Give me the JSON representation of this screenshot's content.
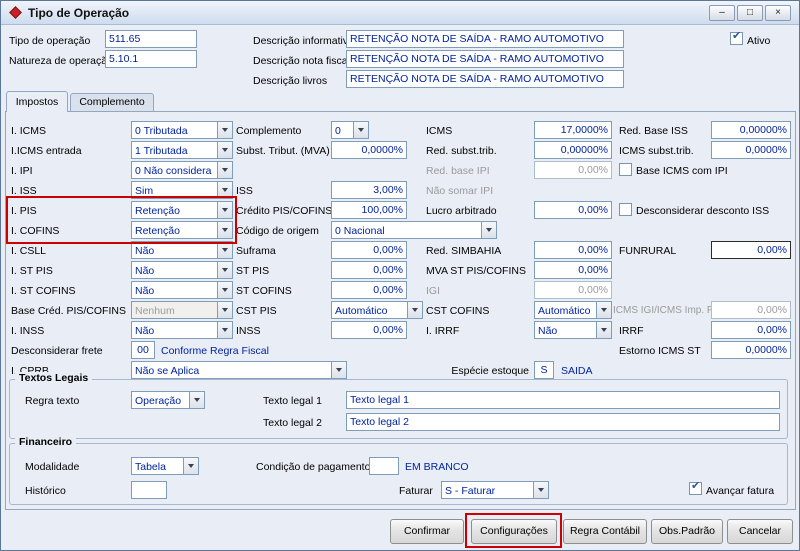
{
  "titlebar": {
    "title": "Tipo de Operação"
  },
  "icons": {
    "minimize": "–",
    "maximize": "□",
    "close": "×",
    "check": "✔",
    "dropdown": "▾"
  },
  "colors": {
    "annotation_red": "#CC0000",
    "field_text_blue": "#0023A0"
  },
  "header": {
    "tipo": {
      "label": "Tipo de operação",
      "value": "511.65"
    },
    "natureza": {
      "label": "Natureza de operação",
      "value": "5.10.1"
    },
    "desc_informativa": {
      "label": "Descrição informativa",
      "value": "RETENÇÃO NOTA DE SAÍDA - RAMO AUTOMOTIVO"
    },
    "desc_nota_fiscal": {
      "label": "Descrição nota fiscal",
      "value": "RETENÇÃO NOTA DE SAÍDA - RAMO AUTOMOTIVO"
    },
    "desc_livros": {
      "label": "Descrição livros",
      "value": "RETENÇÃO NOTA DE SAÍDA - RAMO AUTOMOTIVO"
    },
    "ativo": {
      "label": "Ativo",
      "checked": true
    }
  },
  "tabs": {
    "impostos": "Impostos",
    "complemento": "Complemento"
  },
  "impostos": {
    "icms": {
      "label": "I. ICMS",
      "value": "0 Tributada"
    },
    "icms_entrada": {
      "label": "I.ICMS entrada",
      "value": "1 Tributada"
    },
    "ipi": {
      "label": "I. IPI",
      "value": "0 Não considera"
    },
    "iss": {
      "label": "I. ISS",
      "value": "Sim"
    },
    "pis": {
      "label": "I. PIS",
      "value": "Retenção"
    },
    "cofins": {
      "label": "I. COFINS",
      "value": "Retenção"
    },
    "csll": {
      "label": "I. CSLL",
      "value": "Não"
    },
    "st_pis": {
      "label": "I. ST PIS",
      "value": "Não"
    },
    "st_cofins": {
      "label": "I. ST COFINS",
      "value": "Não"
    },
    "base_cred": {
      "label": "Base Créd. PIS/COFINS",
      "value": "Nenhum",
      "disabled": true
    },
    "inss": {
      "label": "I. INSS",
      "value": "Não"
    },
    "frete": {
      "label": "Desconsiderar frete",
      "value": "00",
      "note": "Conforme Regra Fiscal"
    },
    "cprb": {
      "label": "I. CPRB",
      "value": "Não se Aplica"
    },
    "complemento": {
      "label": "Complemento",
      "value": "0"
    },
    "subst_mva": {
      "label": "Subst. Tribut. (MVA)",
      "value": "0,0000%"
    },
    "iss_pct": {
      "label": "ISS",
      "value": "3,00%"
    },
    "credito": {
      "label": "Crédito PIS/COFINS",
      "value": "100,00%"
    },
    "origem": {
      "label": "Código de origem",
      "value": "0 Nacional"
    },
    "suframa": {
      "label": "Suframa",
      "value": "0,00%"
    },
    "st_pis_pct": {
      "label": "ST PIS",
      "value": "0,00%"
    },
    "st_cofins_pct": {
      "label": "ST COFINS",
      "value": "0,00%"
    },
    "cst_pis": {
      "label": "CST PIS",
      "value": "Automático"
    },
    "inss_pct": {
      "label": "INSS",
      "value": "0,00%"
    },
    "icms_pct": {
      "label": "ICMS",
      "value": "17,0000%"
    },
    "red_subst": {
      "label": "Red. subst.trib.",
      "value": "0,00000%"
    },
    "red_base_ipi": {
      "label": "Red. base IPI",
      "value": "0,00%",
      "disabled": true
    },
    "nao_somar_ipi": {
      "label": "Não somar IPI",
      "disabled": true
    },
    "lucro": {
      "label": "Lucro arbitrado",
      "value": "0,00%"
    },
    "simbahia": {
      "label": "Red. SIMBAHIA",
      "value": "0,00%"
    },
    "mva_st": {
      "label": "MVA ST PIS/COFINS",
      "value": "0,00%"
    },
    "igi": {
      "label": "IGI",
      "value": "0,00%",
      "disabled": true
    },
    "cst_cofins": {
      "label": "CST COFINS",
      "value": "Automático"
    },
    "irrf_sel": {
      "label": "I. IRRF",
      "value": "Não"
    },
    "red_base_iss": {
      "label": "Red. Base ISS",
      "value": "0,00000%"
    },
    "icms_subst": {
      "label": "ICMS subst.trib.",
      "value": "0,0000%"
    },
    "cb_base_icms_ipi": {
      "label": "Base ICMS com IPI",
      "checked": false
    },
    "cb_desc_iss": {
      "label": "Desconsiderar desconto ISS",
      "checked": false
    },
    "funrural": {
      "label": "FUNRURAL",
      "value": "0,00%"
    },
    "icms_igi": {
      "label": "ICMS IGI/ICMS Imp. PR",
      "value": "0,00%",
      "disabled": true
    },
    "irrf_pct": {
      "label": "IRRF",
      "value": "0,00%"
    },
    "estorno": {
      "label": "Estorno ICMS ST",
      "value": "0,0000%"
    },
    "especie": {
      "label": "Espécie estoque",
      "value": "S",
      "note": "SAIDA"
    }
  },
  "textos_legais": {
    "title": "Textos Legais",
    "regra_texto": {
      "label": "Regra texto",
      "value": "Operação"
    },
    "texto_legal_1": {
      "label": "Texto legal 1",
      "value": "Texto legal 1"
    },
    "texto_legal_2": {
      "label": "Texto legal 2",
      "value": "Texto legal 2"
    }
  },
  "financeiro": {
    "title": "Financeiro",
    "modalidade": {
      "label": "Modalidade",
      "value": "Tabela"
    },
    "condicao": {
      "label": "Condição de pagamento",
      "value": "",
      "note": "EM BRANCO"
    },
    "historico": {
      "label": "Histórico",
      "value": ""
    },
    "faturar": {
      "label": "Faturar",
      "value": "S - Faturar"
    },
    "avancar_fatura": {
      "label": "Avançar fatura",
      "checked": true
    }
  },
  "buttons": {
    "confirmar": "Confirmar",
    "configuracoes": "Configurações",
    "regra_contabil": "Regra Contábil",
    "obs_padrao": "Obs.Padrão",
    "cancelar": "Cancelar"
  }
}
